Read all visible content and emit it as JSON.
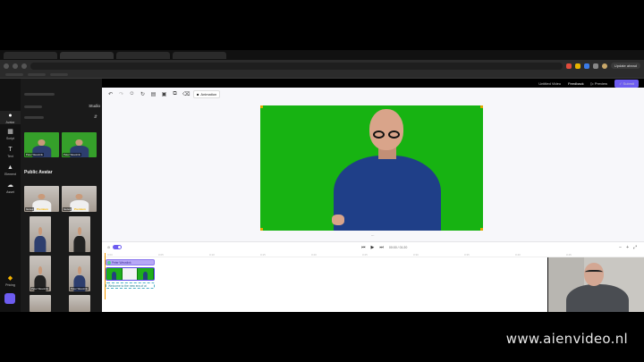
{
  "browser": {
    "update_button": "Update ahead",
    "url_placeholder": ""
  },
  "app_header": {
    "untitled_label": "Untitled Video",
    "feedback": "Feedback",
    "preview": "Preview",
    "submit": "Submit"
  },
  "rail": {
    "items": [
      {
        "label": "Avatar",
        "icon": "person-icon"
      },
      {
        "label": "Script",
        "icon": "doc-icon"
      },
      {
        "label": "Text",
        "icon": "text-icon"
      },
      {
        "label": "Element",
        "icon": "shapes-icon"
      },
      {
        "label": "Asset",
        "icon": "cloud-icon"
      }
    ],
    "pricing": "Pricing"
  },
  "panel": {
    "studio_label": "Studio",
    "public_avatar_title": "Public Avatar",
    "my_avatars": [
      {
        "tag": "Peter Weustink"
      },
      {
        "tag": "Peter Weustink"
      }
    ],
    "public_avatars": [
      {
        "tag": "Genes",
        "premium": "Premium"
      },
      {
        "tag": "Genes",
        "premium": "Premium"
      }
    ],
    "photo_avatars": [
      {
        "tag": "Peter Weustink"
      },
      {
        "tag": "Peter Weustink"
      }
    ]
  },
  "toolbar": {
    "animation": "Animation"
  },
  "timeline": {
    "track_label": "Peter Weustink",
    "track_text": "Welcome to the new era of ai",
    "ruler": [
      "0:00",
      "0:05",
      "0:10",
      "0:15",
      "0:20",
      "0:25",
      "0:30",
      "0:35",
      "0:40",
      "0:45"
    ],
    "time": "00:00 / 01:20"
  },
  "watermark": "www.aienvideo.nl",
  "colors": {
    "accent": "#6d5cf0",
    "green_screen": "#17b312"
  }
}
